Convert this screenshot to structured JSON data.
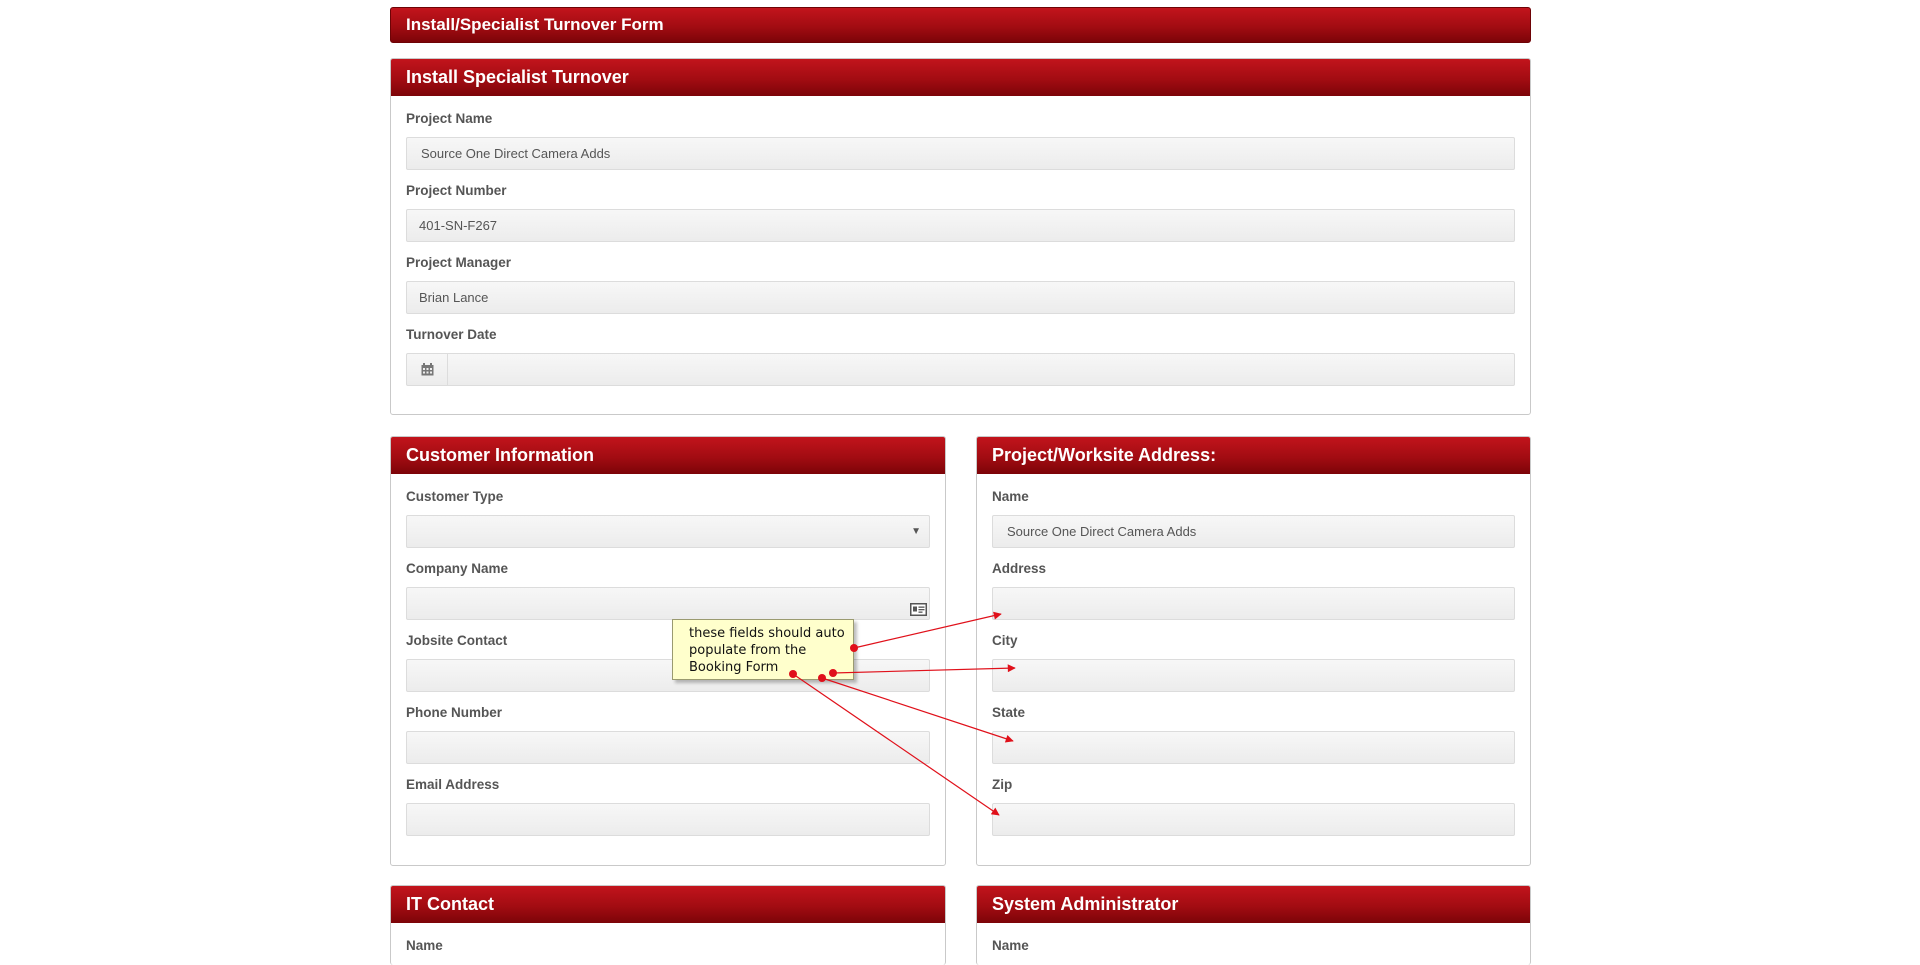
{
  "page": {
    "title": "Install/Specialist Turnover Form"
  },
  "turnover": {
    "title": "Install Specialist Turnover",
    "project_name_label": "Project Name",
    "project_name_value": "Source One Direct Camera Adds",
    "project_number_label": "Project Number",
    "project_number_value": "401-SN-F267",
    "project_manager_label": "Project Manager",
    "project_manager_value": "Brian Lance",
    "turnover_date_label": "Turnover Date",
    "turnover_date_value": ""
  },
  "customer": {
    "title": "Customer Information",
    "customer_type_label": "Customer Type",
    "customer_type_value": "",
    "company_name_label": "Company Name",
    "company_name_value": "",
    "jobsite_contact_label": "Jobsite Contact",
    "phone_label": "Phone Number",
    "email_label": "Email Address"
  },
  "worksite": {
    "title": "Project/Worksite Address:",
    "name_label": "Name",
    "name_value": "Source One Direct Camera Adds",
    "address_label": "Address",
    "city_label": "City",
    "state_label": "State",
    "zip_label": "Zip"
  },
  "it_contact": {
    "title": "IT Contact",
    "name_label": "Name"
  },
  "sysadmin": {
    "title": "System Administrator",
    "name_label": "Name"
  },
  "annotation": {
    "text": "these fields should auto populate from the Booking Form"
  },
  "icons": {
    "calendar": "calendar-icon",
    "dropdown": "chevron-down-icon",
    "contact_card": "contact-card-icon"
  },
  "colors": {
    "header_red": "#a20c12",
    "note_yellow": "#ffffcc",
    "arrow_red": "#e0101a"
  }
}
